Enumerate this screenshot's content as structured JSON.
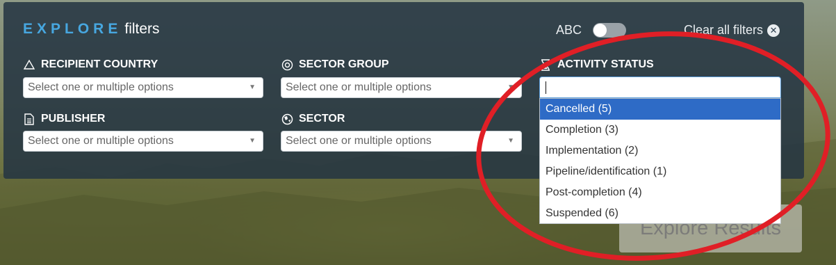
{
  "header": {
    "title_strong": "EXPLORE",
    "title_rest": "filters",
    "abc_label": "ABC",
    "clear_label": "Clear all filters",
    "clear_icon": "close-circle-icon"
  },
  "filters": {
    "recipient_country": {
      "label": "RECIPIENT COUNTRY",
      "placeholder": "Select one or multiple options",
      "icon": "triangle-icon"
    },
    "sector_group": {
      "label": "SECTOR GROUP",
      "placeholder": "Select one or multiple options",
      "icon": "target-icon"
    },
    "activity_status": {
      "label": "ACTIVITY STATUS",
      "icon": "hourglass-icon"
    },
    "publisher": {
      "label": "PUBLISHER",
      "placeholder": "Select one or multiple options",
      "icon": "document-icon"
    },
    "sector": {
      "label": "SECTOR",
      "placeholder": "Select one or multiple options",
      "icon": "globe-icon"
    }
  },
  "dropdown": {
    "options": [
      "Cancelled (5)",
      "Completion (3)",
      "Implementation (2)",
      "Pipeline/identification (1)",
      "Post-completion (4)",
      "Suspended (6)"
    ],
    "highlighted": "Cancelled (5)"
  },
  "explore_button": "Explore Results",
  "colors": {
    "accent": "#47a7e0",
    "highlight": "#2e6bc6",
    "annotation": "#e01f26"
  }
}
